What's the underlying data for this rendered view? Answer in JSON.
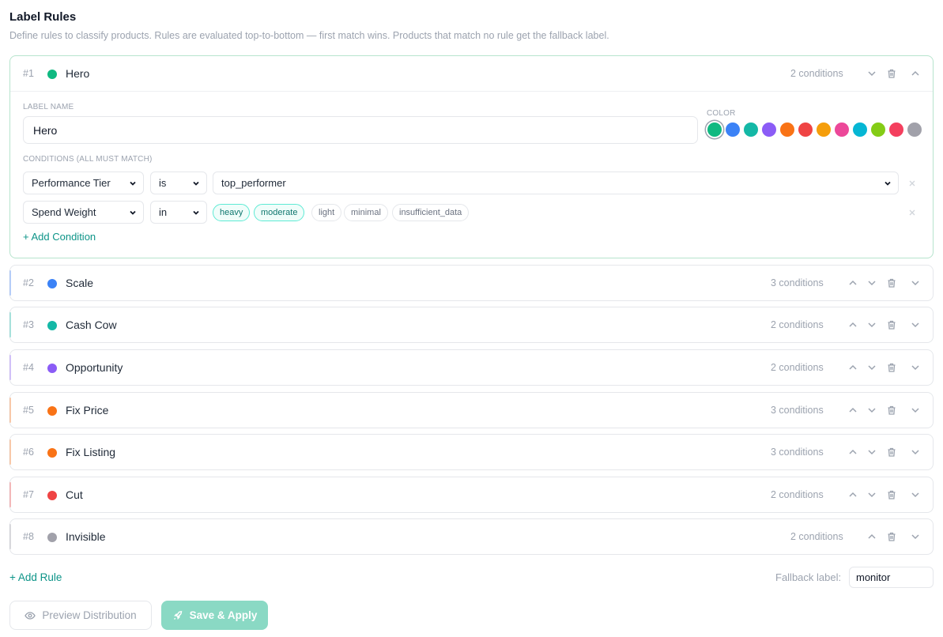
{
  "header": {
    "title": "Label Rules",
    "subtitle": "Define rules to classify products. Rules are evaluated top-to-bottom — first match wins. Products that match no rule get the fallback label."
  },
  "expanded_rule": {
    "number": "#1",
    "name": "Hero",
    "color": "#10b981",
    "conditions_count": "2 conditions",
    "label_name_caption": "LABEL NAME",
    "label_name_value": "Hero",
    "color_caption": "COLOR",
    "palette": [
      {
        "color": "#10b981",
        "selected": true
      },
      {
        "color": "#3b82f6",
        "selected": false
      },
      {
        "color": "#14b8a6",
        "selected": false
      },
      {
        "color": "#8b5cf6",
        "selected": false
      },
      {
        "color": "#f97316",
        "selected": false
      },
      {
        "color": "#ef4444",
        "selected": false
      },
      {
        "color": "#f59e0b",
        "selected": false
      },
      {
        "color": "#ec4899",
        "selected": false
      },
      {
        "color": "#06b6d4",
        "selected": false
      },
      {
        "color": "#84cc16",
        "selected": false
      },
      {
        "color": "#f43f5e",
        "selected": false
      },
      {
        "color": "#a1a1aa",
        "selected": false
      }
    ],
    "conditions_caption": "CONDITIONS (ALL MUST MATCH)",
    "conditions": [
      {
        "field": "Performance Tier",
        "operator": "is",
        "value": "top_performer"
      },
      {
        "field": "Spend Weight",
        "operator": "in",
        "options": [
          {
            "label": "heavy",
            "selected": true
          },
          {
            "label": "moderate",
            "selected": true
          },
          {
            "label": "light",
            "selected": false
          },
          {
            "label": "minimal",
            "selected": false
          },
          {
            "label": "insufficient_data",
            "selected": false
          }
        ]
      }
    ],
    "add_condition_label": "+ Add Condition"
  },
  "rules": [
    {
      "number": "#2",
      "name": "Scale",
      "color": "#3b82f6",
      "count": "3 conditions"
    },
    {
      "number": "#3",
      "name": "Cash Cow",
      "color": "#14b8a6",
      "count": "2 conditions"
    },
    {
      "number": "#4",
      "name": "Opportunity",
      "color": "#8b5cf6",
      "count": "2 conditions"
    },
    {
      "number": "#5",
      "name": "Fix Price",
      "color": "#f97316",
      "count": "3 conditions"
    },
    {
      "number": "#6",
      "name": "Fix Listing",
      "color": "#f97316",
      "count": "3 conditions"
    },
    {
      "number": "#7",
      "name": "Cut",
      "color": "#ef4444",
      "count": "2 conditions"
    },
    {
      "number": "#8",
      "name": "Invisible",
      "color": "#a1a1aa",
      "count": "2 conditions"
    }
  ],
  "footer": {
    "add_rule_label": "+ Add Rule",
    "fallback_caption": "Fallback label:",
    "fallback_value": "monitor",
    "preview_button": "Preview Distribution",
    "save_button": "Save & Apply"
  }
}
